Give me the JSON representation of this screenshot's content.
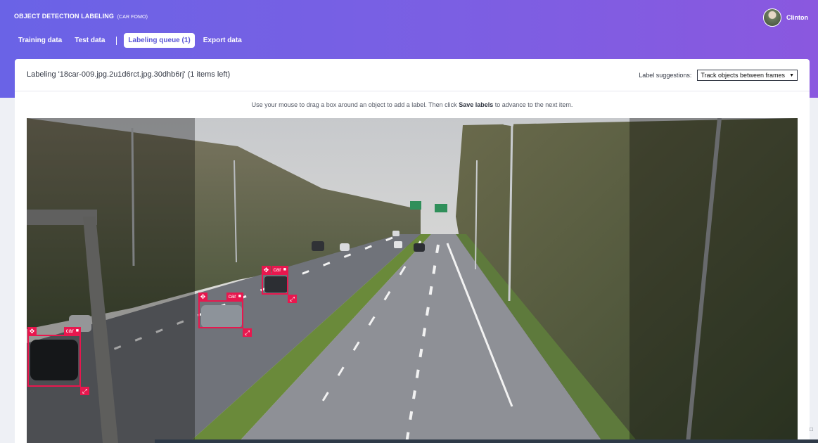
{
  "header": {
    "title": "OBJECT DETECTION LABELING",
    "subtitle": "(CAR FOMO)",
    "user_name": "Clinton"
  },
  "nav": {
    "items": [
      {
        "label": "Training data"
      },
      {
        "label": "Test data"
      },
      {
        "label": "Labeling queue (1)"
      },
      {
        "label": "Export data"
      }
    ]
  },
  "panel": {
    "title": "Labeling '18car-009.jpg.2u1d6rct.jpg.30dhb6rj' (1 items left)",
    "suggestions_label": "Label suggestions:",
    "suggestions_value": "Track objects between frames"
  },
  "instructions": {
    "before": "Use your mouse to drag a box around an object to add a label. Then click",
    "bold": "Save labels",
    "after": "to advance to the next item."
  },
  "boxes": [
    {
      "label": "car"
    },
    {
      "label": "car"
    },
    {
      "label": "car"
    }
  ],
  "colors": {
    "header_start": "#6a63e6",
    "header_end": "#8a58df",
    "label_box": "#e8174e"
  },
  "icons": {
    "move": "move-icon",
    "delete": "trash-icon",
    "resize": "resize-icon",
    "dropdown": "chevron-down-icon",
    "chat": "chat-icon"
  }
}
